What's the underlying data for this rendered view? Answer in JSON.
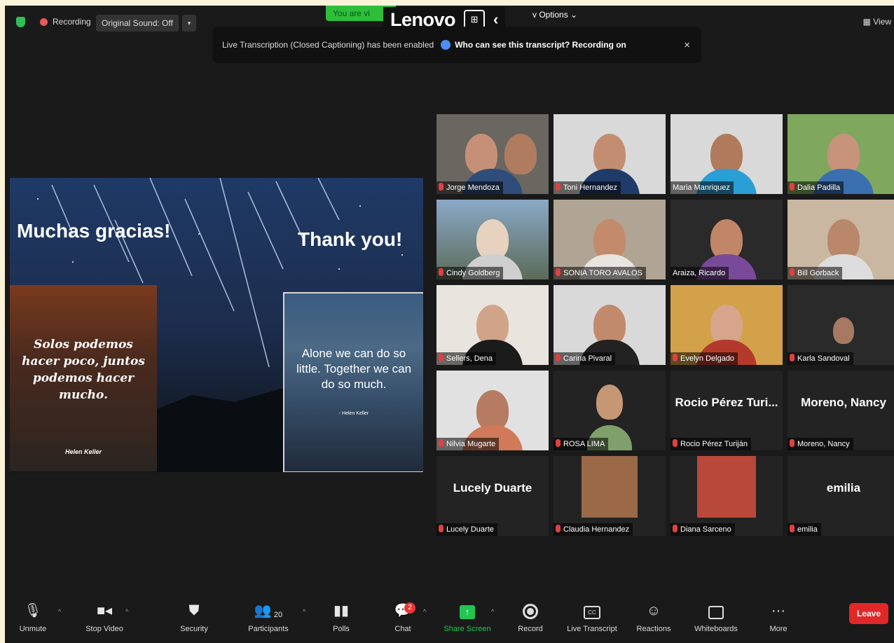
{
  "topbar": {
    "recording": "Recording",
    "original_sound": "Original Sound: Off",
    "viewing_banner": "You are vi",
    "lenovo": "Lenovo",
    "view_options": "v Options ⌄",
    "view": "View"
  },
  "notice": {
    "text": "Live Transcription (Closed Captioning) has been enabled",
    "link": "Who can see this transcript? Recording on",
    "close": "×"
  },
  "slide": {
    "title_es": "Muchas gracias!",
    "title_en": "Thank you!",
    "quote_es": "Solos podemos hacer poco, juntos podemos hacer mucho.",
    "quote_es_author": "Helen Keller",
    "quote_en": "Alone we can do so little. Together we can do so much.",
    "quote_en_author": "- Helen Keller"
  },
  "participants": [
    {
      "name": "Jorge Mendoza",
      "big": ""
    },
    {
      "name": "Toni Hernandez",
      "big": ""
    },
    {
      "name": "Maria Manriquez",
      "big": ""
    },
    {
      "name": "Dalia Padilla",
      "big": ""
    },
    {
      "name": "Cindy Goldberg",
      "big": ""
    },
    {
      "name": "SONIA TORO AVALOS",
      "big": ""
    },
    {
      "name": "Araiza, Ricardo",
      "big": ""
    },
    {
      "name": "Bill Gorback",
      "big": ""
    },
    {
      "name": "Sellers, Dena",
      "big": ""
    },
    {
      "name": "Carina Pivaral",
      "big": ""
    },
    {
      "name": "Evelyn Delgado",
      "big": ""
    },
    {
      "name": "Karla Sandoval",
      "big": ""
    },
    {
      "name": "Nilvia Mugarte",
      "big": ""
    },
    {
      "name": "ROSA LIMA",
      "big": ""
    },
    {
      "name": "Rocio Pérez Turiján",
      "big": "Rocio Pérez Turi..."
    },
    {
      "name": "Moreno, Nancy",
      "big": "Moreno, Nancy"
    },
    {
      "name": "Lucely Duarte",
      "big": "Lucely Duarte"
    },
    {
      "name": "Claudia Hernandez",
      "big": ""
    },
    {
      "name": "Diana Sarceno",
      "big": ""
    },
    {
      "name": "emilia",
      "big": "emilia"
    }
  ],
  "toolbar": {
    "unmute": "Unmute",
    "stop_video": "Stop Video",
    "security": "Security",
    "participants": "Participants",
    "participants_count": "20",
    "polls": "Polls",
    "chat": "Chat",
    "chat_badge": "2",
    "share_screen": "Share Screen",
    "record": "Record",
    "live_transcript": "Live Transcript",
    "cc": "CC",
    "reactions": "Reactions",
    "whiteboards": "Whiteboards",
    "more": "More",
    "leave": "Leave"
  },
  "colors": {
    "active_speaker": "#d6e86a",
    "share_green": "#23c552",
    "leave_red": "#e02828"
  }
}
